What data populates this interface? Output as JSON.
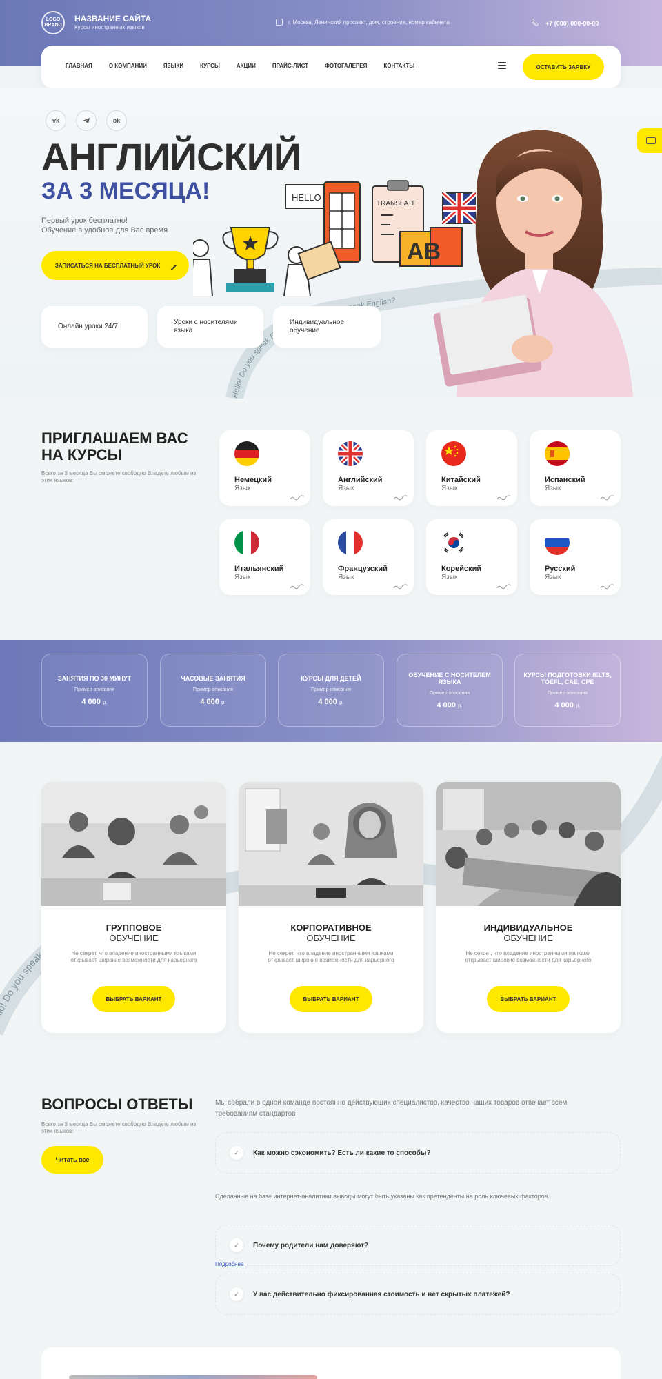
{
  "header": {
    "logo": "LOGO\nBRAND",
    "site_name": "НАЗВАНИЕ САЙТА",
    "site_sub": "Курсы иностранных языков",
    "address": "г. Москва, Ленинский проспект, дом, строение, номер кабинета",
    "phone": "+7 (000) 000-00-00"
  },
  "nav": {
    "items": [
      "ГЛАВНАЯ",
      "О КОМПАНИИ",
      "ЯЗЫКИ",
      "КУРСЫ",
      "АКЦИИ",
      "ПРАЙС-ЛИСТ",
      "ФОТОГАЛЕРЕЯ",
      "КОНТАКТЫ"
    ],
    "cta": "ОСТАВИТЬ ЗАЯВКУ"
  },
  "hero": {
    "socials": [
      "vk",
      "tg",
      "ok"
    ],
    "title": "АНГЛИЙСКИЙ",
    "subtitle": "ЗА 3 МЕСЯЦА!",
    "text1": "Первый урок бесплатно!",
    "text2": "Обучение  в удобное для Вас время",
    "button": "ЗАПИСАТЬСЯ НА БЕСПЛАТНЫЙ УРОК",
    "features": [
      "Онлайн уроки 24/7",
      "Уроки с носителями языка",
      "Индивидуальное обучение"
    ],
    "illus_texts": [
      "HELLO",
      "TRANSLATE",
      "AB"
    ],
    "ribbon_text": "Hello! Do you speak English? Hello! Do you speak English?"
  },
  "courses": {
    "title": "ПРИГЛАШАЕМ ВАС НА КУРСЫ",
    "text": "Всего за 3 месяца Вы сможете свободно Владеть любым из этих языков:",
    "sub_label": "Язык",
    "languages": [
      {
        "name": "Немецкий",
        "flag": "de"
      },
      {
        "name": "Английский",
        "flag": "gb"
      },
      {
        "name": "Китайский",
        "flag": "cn"
      },
      {
        "name": "Испанский",
        "flag": "es"
      },
      {
        "name": "Итальянский",
        "flag": "it"
      },
      {
        "name": "Французский",
        "flag": "fr"
      },
      {
        "name": "Корейский",
        "flag": "kr"
      },
      {
        "name": "Русский",
        "flag": "ru"
      }
    ]
  },
  "prices": {
    "items": [
      {
        "title": "ЗАНЯТИЯ ПО 30 МИНУТ",
        "desc": "Пример описания",
        "price": "4 000",
        "cur": "р."
      },
      {
        "title": "ЧАСОВЫЕ ЗАНЯТИЯ",
        "desc": "Пример описания",
        "price": "4 000",
        "cur": "р."
      },
      {
        "title": "КУРСЫ ДЛЯ ДЕТЕЙ",
        "desc": "Пример описания",
        "price": "4 000",
        "cur": "р."
      },
      {
        "title": "ОБУЧЕНИЕ С НОСИТЕЛЕМ ЯЗЫКА",
        "desc": "Пример описания",
        "price": "4 000",
        "cur": "р."
      },
      {
        "title": "КУРСЫ ПОДГОТОВКИ IELTS, TOEFL, CAE, CPE",
        "desc": "Пример описания",
        "price": "4 000",
        "cur": "р."
      }
    ]
  },
  "formats": {
    "items": [
      {
        "t1": "ГРУППОВОЕ",
        "t2": "ОБУЧЕНИЕ",
        "text": "Не секрет, что владение иностранными языками открывает широкие возможности для карьерного",
        "button": "ВЫБРАТЬ ВАРИАНТ"
      },
      {
        "t1": "КОРПОРАТИВНОЕ",
        "t2": "ОБУЧЕНИЕ",
        "text": "Не секрет, что владение иностранными языками открывает широкие возможности для карьерного",
        "button": "ВЫБРАТЬ ВАРИАНТ"
      },
      {
        "t1": "ИНДИВИДУАЛЬНОЕ",
        "t2": "ОБУЧЕНИЕ",
        "text": "Не секрет, что владение иностранными языками открывает широкие возможности для карьерного",
        "button": "ВЫБРАТЬ ВАРИАНТ"
      }
    ],
    "ribbon_text": "Hello! Do you speak English? Hello! Do you speak English?"
  },
  "faq": {
    "title": "ВОПРОСЫ ОТВЕТЫ",
    "text": "Всего за 3 месяца Вы сможете свободно Владеть любым из этих языков:",
    "button": "Читать все",
    "lead": "Мы собрали в одной команде постоянно действующих специалистов, качество наших товаров отвечает всем требованиям стандартов",
    "q1": "Как можно сэкономить? Есть ли какие то способы?",
    "answer": "Сделанные на базе интернет-аналитики выводы могут быть указаны как претенденты на роль ключевых факторов.",
    "q2": "Почему родители нам доверяют?",
    "more": "Подробнее",
    "q3": "У вас действительно фиксированная стоимость и нет скрытых платежей?"
  }
}
